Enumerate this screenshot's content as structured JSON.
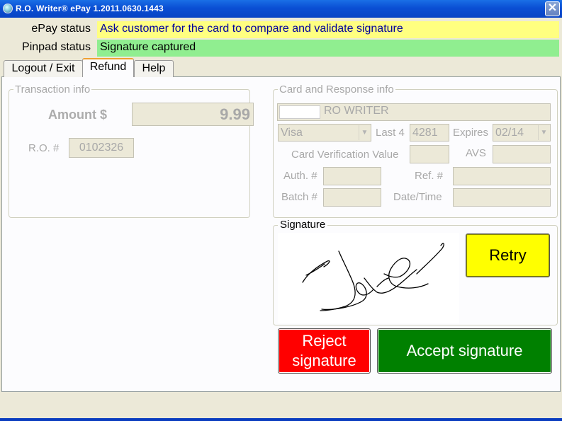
{
  "window": {
    "title": "R.O. Writer® ePay 1.2011.0630.1443",
    "close_symbol": "✕"
  },
  "status": {
    "epay_label": "ePay status",
    "epay_value": "Ask customer for the card to compare and validate signature",
    "pinpad_label": "Pinpad status",
    "pinpad_value": "Signature captured"
  },
  "tabs": [
    {
      "label": "Logout / Exit",
      "active": false
    },
    {
      "label": "Refund",
      "active": true
    },
    {
      "label": "Help",
      "active": false
    }
  ],
  "transaction": {
    "legend": "Transaction info",
    "amount_label": "Amount $",
    "amount_value": "9.99",
    "ro_label": "R.O. #",
    "ro_value": "0102326"
  },
  "card": {
    "legend": "Card and Response info",
    "holder_name": "RO WRITER",
    "card_type": "Visa",
    "last4_label": "Last 4",
    "last4_value": "4281",
    "expires_label": "Expires",
    "expires_value": "02/14",
    "cvv_label": "Card Verification Value",
    "cvv_value": "",
    "avs_label": "AVS",
    "avs_value": "",
    "auth_label": "Auth. #",
    "auth_value": "",
    "ref_label": "Ref. #",
    "ref_value": "",
    "batch_label": "Batch #",
    "batch_value": "",
    "datetime_label": "Date/Time",
    "datetime_value": ""
  },
  "signature": {
    "legend": "Signature",
    "retry_label": "Retry",
    "reject_line1": "Reject",
    "reject_line2": "signature",
    "accept_label": "Accept signature"
  },
  "colors": {
    "epay_status_bg": "#ffff80",
    "epay_status_text": "#00009c",
    "pinpad_status_bg": "#90ee90",
    "retry_bg": "#ffff00",
    "reject_bg": "#ff0000",
    "accept_bg": "#008000"
  },
  "icons": {
    "app": "app-icon",
    "close": "close-icon",
    "dropdown": "chevron-down-icon"
  }
}
